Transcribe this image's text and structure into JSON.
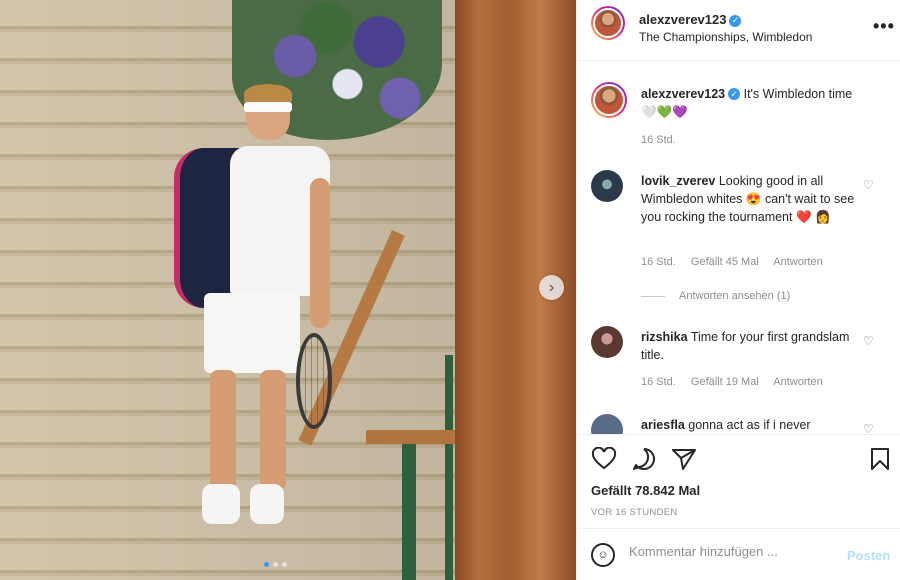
{
  "header": {
    "username": "alexzverev123",
    "location": "The Championships, Wimbledon",
    "more_icon": "more-horizontal-icon"
  },
  "caption": {
    "username": "alexzverev123",
    "text": "It's Wimbledon time",
    "emojis": "🤍💚💜",
    "time": "16 Std."
  },
  "comments": [
    {
      "username": "lovik_zverev",
      "text": "Looking good in all Wimbledon whites 😍 can't wait to see you rocking the tournament ❤️ 👩",
      "time": "16 Std.",
      "likes": "Gefällt 45 Mal",
      "reply": "Antworten",
      "view_replies": "Antworten ansehen (1)"
    },
    {
      "username": "rizshika",
      "text": "Time for your first grandslam title.",
      "time": "16 Std.",
      "likes": "Gefällt 19 Mal",
      "reply": "Antworten"
    },
    {
      "username": "ariesfla",
      "text": "gonna act as if i never"
    }
  ],
  "actions": {
    "likes": "Gefällt 78.842 Mal",
    "timestamp": "VOR 16 STUNDEN"
  },
  "add_comment": {
    "placeholder": "Kommentar hinzufügen ...",
    "post_label": "Posten"
  },
  "colors": {
    "accent": "#3897f0",
    "post_button_disabled": "#b2dffc",
    "muted_text": "#8e8e8e"
  }
}
